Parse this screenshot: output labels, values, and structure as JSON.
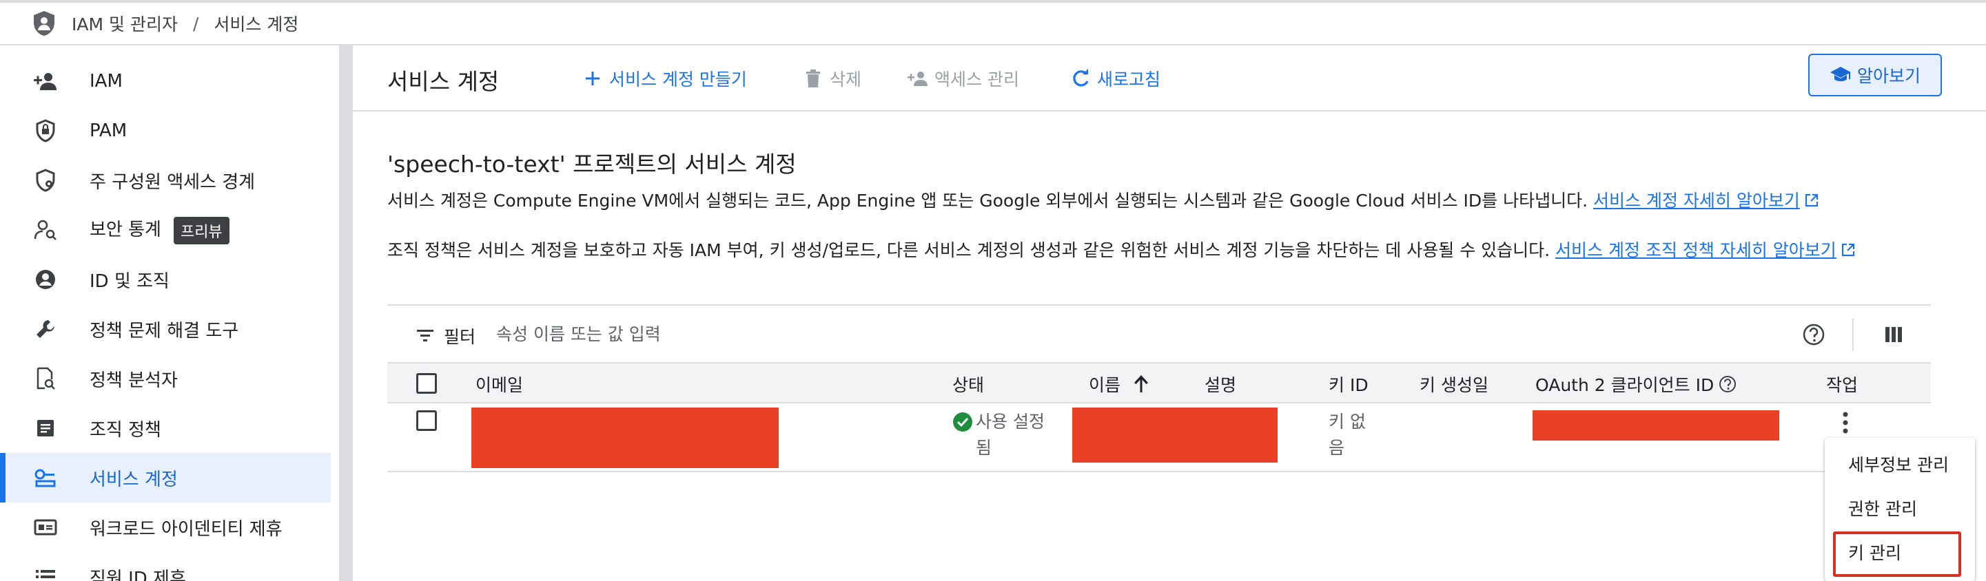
{
  "breadcrumb": {
    "root": "IAM 및 관리자",
    "separator": "/",
    "current": "서비스 계정"
  },
  "sidebar": {
    "items": [
      {
        "label": "IAM",
        "icon": "person-add-icon"
      },
      {
        "label": "PAM",
        "icon": "shield-lock-icon"
      },
      {
        "label": "주 구성원 액세스 경계",
        "icon": "shield-gear-icon"
      },
      {
        "label": "보안 통계",
        "icon": "person-search-icon",
        "badge": "프리뷰"
      },
      {
        "label": "ID 및 조직",
        "icon": "account-circle-icon"
      },
      {
        "label": "정책 문제 해결 도구",
        "icon": "wrench-icon"
      },
      {
        "label": "정책 분석자",
        "icon": "doc-search-icon"
      },
      {
        "label": "조직 정책",
        "icon": "article-icon"
      },
      {
        "label": "서비스 계정",
        "icon": "service-account-icon",
        "active": true
      },
      {
        "label": "워크로드 아이덴티티 제휴",
        "icon": "id-card-icon"
      },
      {
        "label": "직원 ID 제휴",
        "icon": "list-icon"
      }
    ]
  },
  "toolbar": {
    "title": "서비스 계정",
    "create_label": "서비스 계정 만들기",
    "delete_label": "삭제",
    "manage_access_label": "액세스 관리",
    "refresh_label": "새로고침",
    "learn_label": "알아보기"
  },
  "content": {
    "heading": "'speech-to-text' 프로젝트의 서비스 계정",
    "desc1": "서비스 계정은 Compute Engine VM에서 실행되는 코드, App Engine 앱 또는 Google 외부에서 실행되는 시스템과 같은 Google Cloud 서비스 ID를 나타냅니다.",
    "desc1_link": "서비스 계정 자세히 알아보기",
    "desc2": "조직 정책은 서비스 계정을 보호하고 자동 IAM 부여, 키 생성/업로드, 다른 서비스 계정의 생성과 같은 위험한 서비스 계정 기능을 차단하는 데 사용될 수 있습니다.",
    "desc2_link": "서비스 계정 조직 정책 자세히 알아보기"
  },
  "table": {
    "filter_label": "필터",
    "filter_placeholder": "속성 이름 또는 값 입력",
    "columns": {
      "email": "이메일",
      "status": "상태",
      "name": "이름",
      "description": "설명",
      "key_id": "키 ID",
      "key_created": "키 생성일",
      "oauth": "OAuth 2 클라이언트 ID",
      "actions": "작업"
    },
    "rows": [
      {
        "status": "사용 설정됨",
        "key_id": "키 없음"
      }
    ]
  },
  "menu": {
    "items": [
      "세부정보 관리",
      "권한 관리",
      "키 관리"
    ]
  },
  "colors": {
    "accent": "#1a73e8",
    "redaction": "#ea4026",
    "highlight": "#d93025"
  }
}
